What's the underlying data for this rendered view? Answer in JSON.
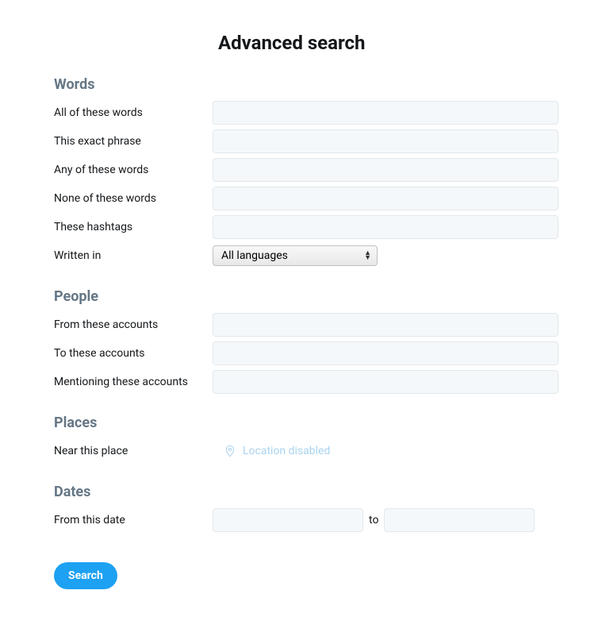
{
  "page_title": "Advanced search",
  "sections": {
    "words": {
      "heading": "Words",
      "all_words_label": "All of these words",
      "exact_phrase_label": "This exact phrase",
      "any_words_label": "Any of these words",
      "none_words_label": "None of these words",
      "hashtags_label": "These hashtags",
      "written_in_label": "Written in",
      "language_selected": "All languages"
    },
    "people": {
      "heading": "People",
      "from_accounts_label": "From these accounts",
      "to_accounts_label": "To these accounts",
      "mentioning_label": "Mentioning these accounts"
    },
    "places": {
      "heading": "Places",
      "near_place_label": "Near this place",
      "location_disabled_text": "Location disabled"
    },
    "dates": {
      "heading": "Dates",
      "from_date_label": "From this date",
      "to_text": "to"
    }
  },
  "search_button_label": "Search"
}
